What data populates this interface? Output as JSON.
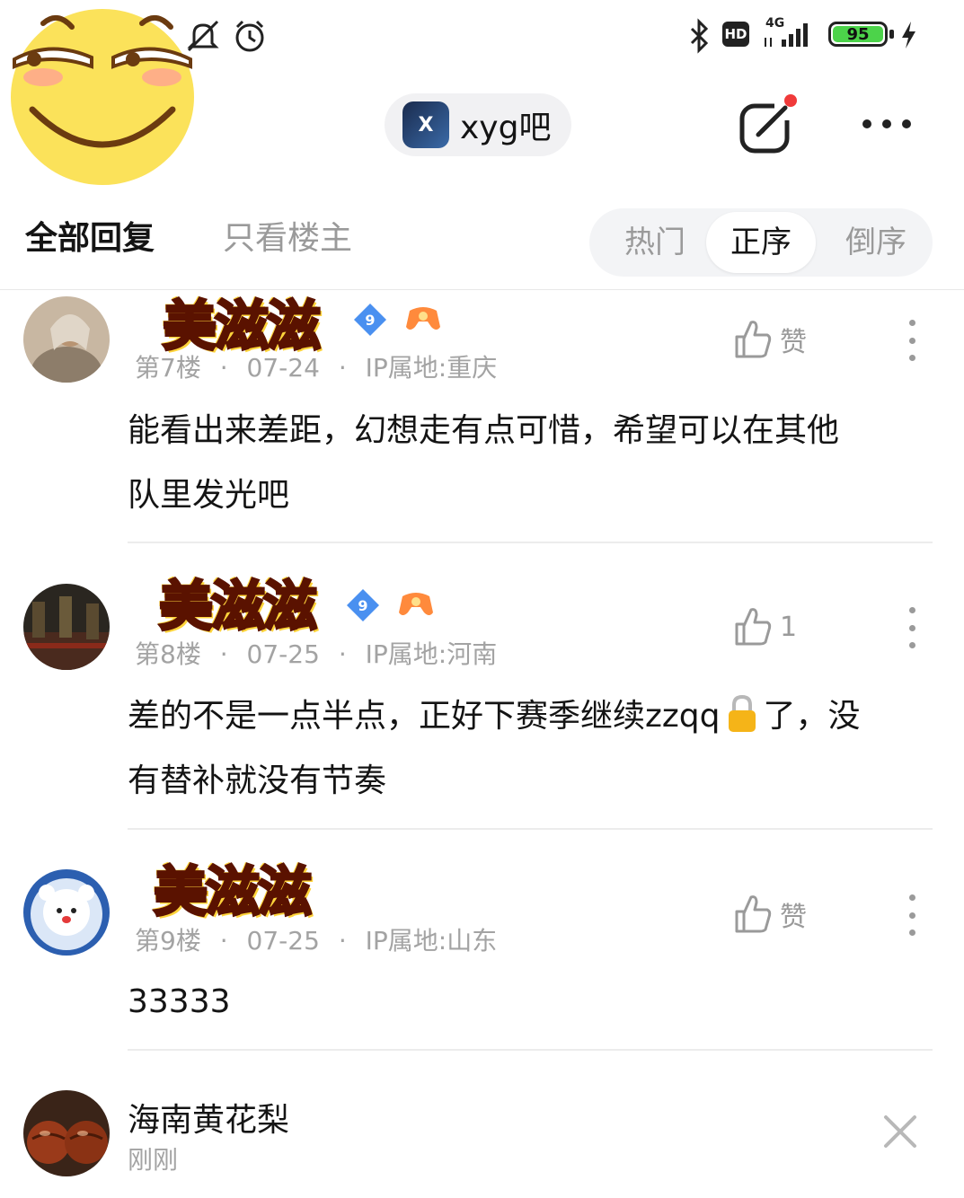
{
  "status_bar": {
    "network": "4G",
    "hd": "HD",
    "battery": "95"
  },
  "header": {
    "forum_name": "xyg吧",
    "forum_logo_text": "X"
  },
  "tabs": {
    "all": "全部回复",
    "owner_only": "只看楼主",
    "sort": [
      "热门",
      "正序",
      "倒序"
    ],
    "sort_selected": "正序"
  },
  "posts": [
    {
      "name_sticker": "美滋滋",
      "level": "9",
      "floor": "第7楼",
      "date": "07-24",
      "ip": "IP属地:重庆",
      "like_label": "赞",
      "body_line1": "能看出来差距，幻想走有点可惜，希望可以在其他",
      "body_line2": "队里发光吧"
    },
    {
      "name_sticker": "美滋滋",
      "level": "9",
      "floor": "第8楼",
      "date": "07-25",
      "ip": "IP属地:河南",
      "like_label": "1",
      "body_part1": "差的不是一点半点，正好下赛季继续zzqq",
      "body_part2": "了，没",
      "body_line2": "有替补就没有节奏"
    },
    {
      "name_sticker": "美滋滋",
      "floor": "第9楼",
      "date": "07-25",
      "ip": "IP属地:山东",
      "like_label": "赞",
      "body_line1": "33333"
    }
  ],
  "reply_preview": {
    "name": "海南黄花梨",
    "time": "刚刚"
  },
  "meta_separator": "·",
  "colors": {
    "accent_red": "#f03a3a",
    "battery_green": "#4cd34a",
    "muted_text": "#a3a3a3",
    "level_badge": "#4a90f0"
  }
}
